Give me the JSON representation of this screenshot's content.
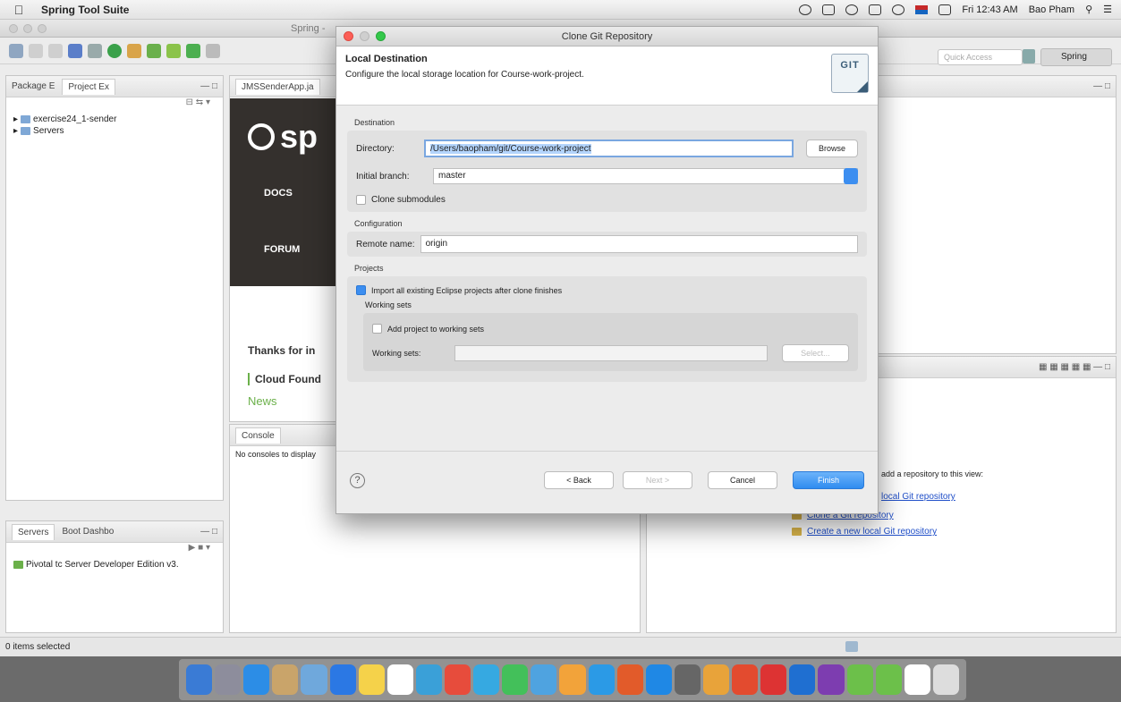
{
  "menubar": {
    "app_name": "Spring Tool Suite",
    "clock": "Fri 12:43 AM",
    "user": "Bao Pham"
  },
  "eclipse": {
    "window_title": "Spring -",
    "quick_access_placeholder": "Quick Access",
    "perspective": "Spring",
    "package_tab": "Package E",
    "project_tab": "Project Ex",
    "tree": [
      "exercise24_1-sender",
      "Servers"
    ],
    "editor_tab": "JMSSenderApp.ja",
    "banner": {
      "logo_text": "sp",
      "nav": [
        "DOCS",
        "FORUM"
      ]
    },
    "dashboard_lines": [
      "Thanks for in",
      "Cloud Found",
      "News"
    ],
    "console_tab": "Console",
    "console_msg": "No consoles to display",
    "servers_tab": "Servers",
    "boot_tab": "Boot Dashbo",
    "server_item": "Pivotal tc Server Developer Edition v3.",
    "git_panel": {
      "hint": "add a repository to this view:",
      "links": [
        "local Git repository",
        "Clone a Git repository",
        "Create a new local Git repository"
      ]
    },
    "status": "0 items selected"
  },
  "dialog": {
    "title": "Clone Git Repository",
    "header": "Local Destination",
    "description": "Configure the local storage location for Course-work-project.",
    "git_logo_text": "GIT",
    "destination": {
      "group_label": "Destination",
      "directory_label": "Directory:",
      "directory_value": "/Users/baopham/git/Course-work-project",
      "browse_button": "Browse",
      "branch_label": "Initial branch:",
      "branch_value": "master",
      "submodules_label": "Clone submodules"
    },
    "configuration": {
      "group_label": "Configuration",
      "remote_label": "Remote name:",
      "remote_value": "origin"
    },
    "projects": {
      "group_label": "Projects",
      "import_label": "Import all existing Eclipse projects after clone finishes",
      "working_sets_group": "Working sets",
      "add_to_sets_label": "Add project to working sets",
      "working_sets_label": "Working sets:",
      "select_button": "Select..."
    },
    "buttons": {
      "help": "?",
      "back": "< Back",
      "next": "Next >",
      "cancel": "Cancel",
      "finish": "Finish"
    }
  },
  "dock_colors": [
    "#3a7bd5",
    "#8d8d9c",
    "#2c8de6",
    "#c9a46a",
    "#6fa8dc",
    "#2b78e4",
    "#f5d24a",
    "#ffffff",
    "#3aa0d8",
    "#e74c3c",
    "#36a9e1",
    "#43c05a",
    "#4fa3e0",
    "#f2a33a",
    "#2b9ae6",
    "#e25b2a",
    "#1f88e5",
    "#666666",
    "#e8a33a",
    "#e34b2f",
    "#d33",
    "#1f6fd1",
    "#7d3db0",
    "#6cc04a",
    "#6cc04a",
    "#ffffff",
    "#dddddd"
  ]
}
